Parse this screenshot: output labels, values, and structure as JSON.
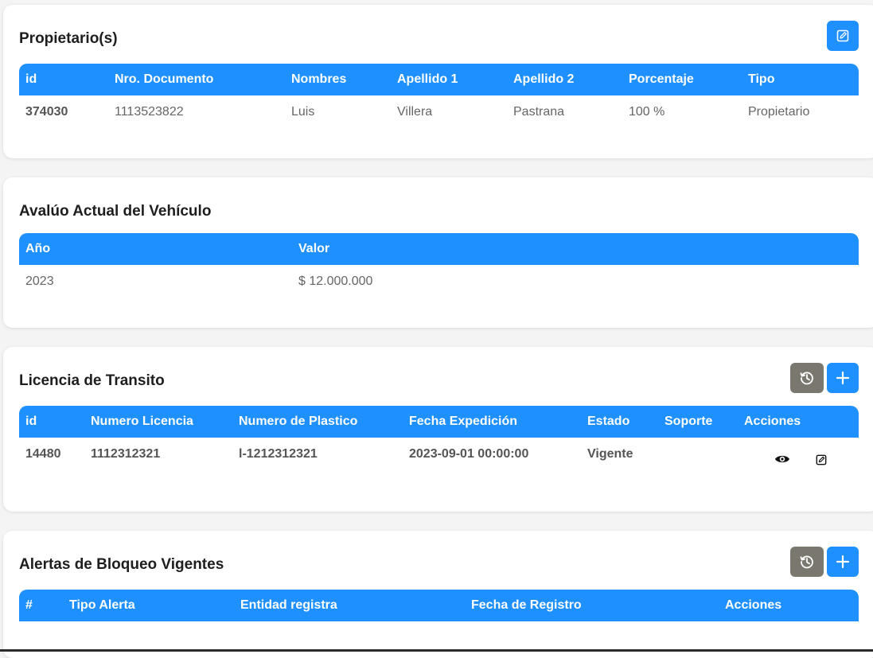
{
  "owners": {
    "title": "Propietario(s)",
    "headers": [
      "id",
      "Nro. Documento",
      "Nombres",
      "Apellido 1",
      "Apellido 2",
      "Porcentaje",
      "Tipo"
    ],
    "rows": [
      [
        "374030",
        "1113523822",
        "Luis",
        "Villera",
        "Pastrana",
        "100 %",
        "Propietario"
      ]
    ],
    "edit_icon": "edit-icon"
  },
  "appraisal": {
    "title": "Avalúo Actual del Vehículo",
    "headers": [
      "Año",
      "Valor"
    ],
    "rows": [
      [
        "2023",
        "$ 12.000.000"
      ]
    ]
  },
  "license": {
    "title": "Licencia de Transito",
    "headers": [
      "id",
      "Numero Licencia",
      "Numero de Plastico",
      "Fecha Expedición",
      "Estado",
      "Soporte",
      "Acciones"
    ],
    "rows": [
      [
        "14480",
        "1112312321",
        "l-1212312321",
        "2023-09-01 00:00:00",
        "Vigente",
        ""
      ]
    ],
    "history_icon": "history-icon",
    "add_icon": "plus-icon",
    "row_actions": [
      "eye-icon",
      "edit-icon"
    ]
  },
  "alerts": {
    "title": "Alertas de Bloqueo Vigentes",
    "headers": [
      "#",
      "Tipo Alerta",
      "Entidad registra",
      "Fecha de Registro",
      "Acciones"
    ],
    "rows": [],
    "history_icon": "history-icon",
    "add_icon": "plus-icon"
  },
  "colors": {
    "header_blue": "#1e90ff",
    "history_gray": "#7a776f",
    "background": "#f4f4f4"
  }
}
